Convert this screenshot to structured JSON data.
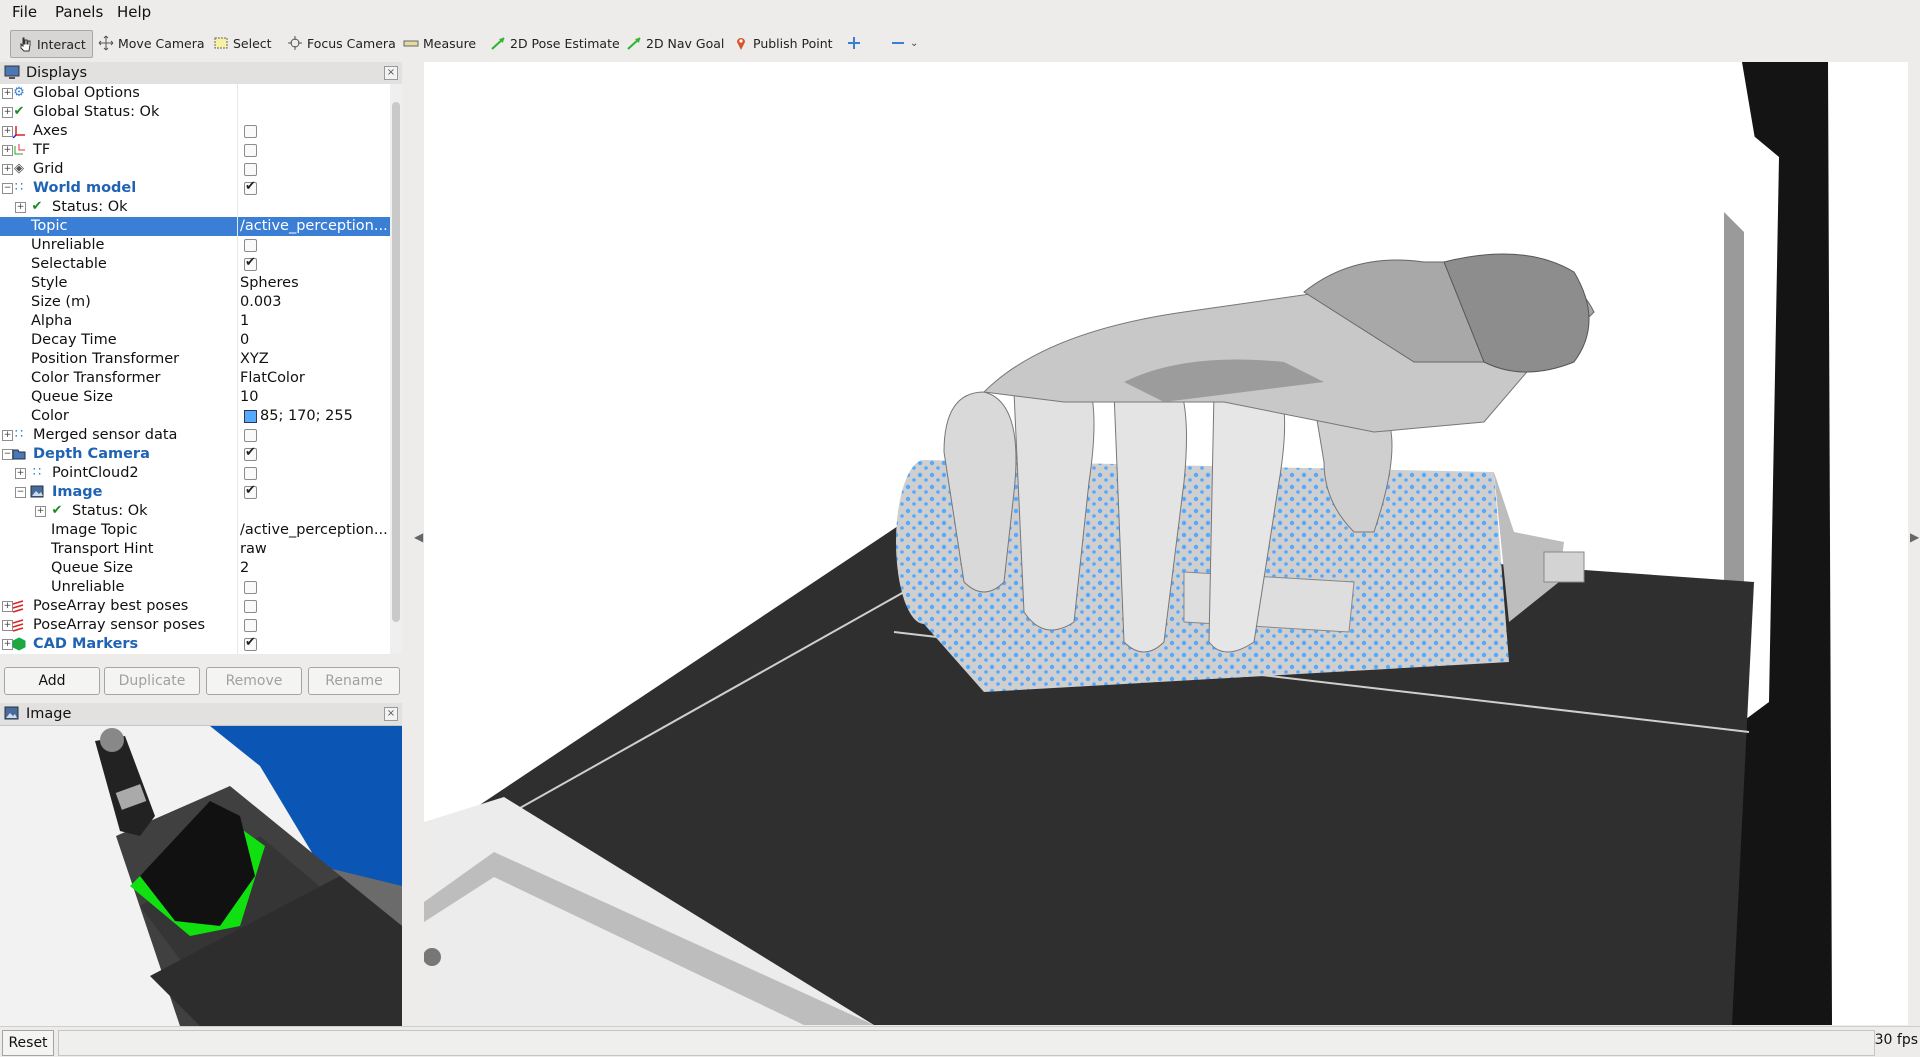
{
  "menu": [
    "File",
    "Panels",
    "Help"
  ],
  "toolbar": {
    "interact": "Interact",
    "move_camera": "Move Camera",
    "select": "Select",
    "focus_camera": "Focus Camera",
    "measure": "Measure",
    "pose_estimate": "2D Pose Estimate",
    "nav_goal": "2D Nav Goal",
    "publish_point": "Publish Point"
  },
  "displays_panel": {
    "title": "Displays",
    "rows": [
      {
        "label": "Global Options",
        "value": ""
      },
      {
        "label": "Global Status: Ok",
        "value": ""
      },
      {
        "label": "Axes",
        "value": ""
      },
      {
        "label": "TF",
        "value": ""
      },
      {
        "label": "Grid",
        "value": ""
      },
      {
        "label": "World model",
        "value": ""
      },
      {
        "label": "Status: Ok",
        "value": ""
      },
      {
        "label": "Topic",
        "value": "/active_perception..."
      },
      {
        "label": "Unreliable",
        "value": ""
      },
      {
        "label": "Selectable",
        "value": ""
      },
      {
        "label": "Style",
        "value": "Spheres"
      },
      {
        "label": "Size (m)",
        "value": "0.003"
      },
      {
        "label": "Alpha",
        "value": "1"
      },
      {
        "label": "Decay Time",
        "value": "0"
      },
      {
        "label": "Position Transformer",
        "value": "XYZ"
      },
      {
        "label": "Color Transformer",
        "value": "FlatColor"
      },
      {
        "label": "Queue Size",
        "value": "10"
      },
      {
        "label": "Color",
        "value": "85; 170; 255"
      },
      {
        "label": "Merged sensor data",
        "value": ""
      },
      {
        "label": "Depth Camera",
        "value": ""
      },
      {
        "label": "PointCloud2",
        "value": ""
      },
      {
        "label": "Image",
        "value": ""
      },
      {
        "label": "Status: Ok",
        "value": ""
      },
      {
        "label": "Image Topic",
        "value": "/active_perception..."
      },
      {
        "label": "Transport Hint",
        "value": "raw"
      },
      {
        "label": "Queue Size",
        "value": "2"
      },
      {
        "label": "Unreliable",
        "value": ""
      },
      {
        "label": "PoseArray best poses",
        "value": ""
      },
      {
        "label": "PoseArray sensor poses",
        "value": ""
      },
      {
        "label": "CAD Markers",
        "value": ""
      }
    ],
    "buttons": {
      "add": "Add",
      "duplicate": "Duplicate",
      "remove": "Remove",
      "rename": "Rename"
    }
  },
  "image_panel": {
    "title": "Image"
  },
  "status": {
    "reset": "Reset",
    "fps": "30 fps"
  },
  "colors": {
    "point_color": "#55aaff",
    "selection": "#3a7fd5"
  }
}
